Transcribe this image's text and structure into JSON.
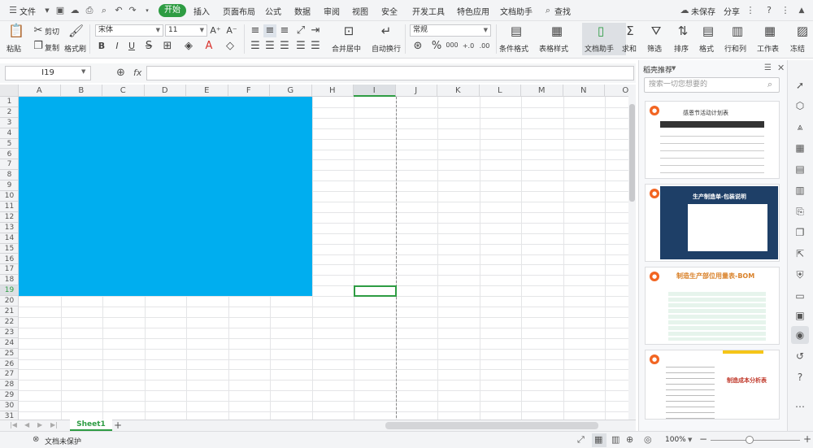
{
  "menubar": {
    "file_label": "文件",
    "tabs": [
      "开始",
      "插入",
      "页面布局",
      "公式",
      "数据",
      "审阅",
      "视图",
      "安全",
      "开发工具",
      "特色应用",
      "文档助手"
    ],
    "search_label": "查找",
    "unsaved_label": "未保存",
    "share_label": "分享"
  },
  "toolbar": {
    "paste": "粘贴",
    "cut": "剪切",
    "copy": "复制",
    "format_painter": "格式刷",
    "font_name": "宋体",
    "font_size": "11",
    "bold": "B",
    "italic": "I",
    "underline": "U",
    "merge_center": "合并居中",
    "wrap_text": "自动换行",
    "number_format": "常规",
    "percent": "%",
    "thousands": "000",
    "cond_format": "条件格式",
    "table_style": "表格样式",
    "doc_assistant": "文档助手",
    "sum": "求和",
    "filter": "筛选",
    "sort": "排序",
    "format": "格式",
    "row_col": "行和列",
    "worksheet": "工作表",
    "freeze": "冻结"
  },
  "formula": {
    "cell_ref": "I19",
    "fx": "fx"
  },
  "grid": {
    "columns": [
      "A",
      "B",
      "C",
      "D",
      "E",
      "F",
      "G",
      "H",
      "I",
      "J",
      "K",
      "L",
      "M",
      "N",
      "O"
    ],
    "rows": [
      "1",
      "2",
      "3",
      "4",
      "5",
      "6",
      "7",
      "8",
      "9",
      "10",
      "11",
      "12",
      "13",
      "14",
      "15",
      "16",
      "17",
      "18",
      "19",
      "20",
      "21",
      "22",
      "23",
      "24",
      "25",
      "26",
      "27",
      "28",
      "29",
      "30",
      "31"
    ],
    "fill_color": "#00aeef",
    "active_col": "I",
    "active_row": "19"
  },
  "sheets": {
    "tabs": [
      "Sheet1"
    ],
    "add": "+"
  },
  "status": {
    "protect_label": "文档未保护",
    "zoom": "100%"
  },
  "panel": {
    "title": "稻壳推荐",
    "search_placeholder": "搜索一切您想要的",
    "cards": [
      {
        "title": "感恩节活动计划表"
      },
      {
        "title": "生产制造单-包装说明"
      },
      {
        "title": "制造生产部位用量表-BOM"
      },
      {
        "title": "制造成本分析表"
      }
    ]
  },
  "accent_color": "#2e9c43"
}
